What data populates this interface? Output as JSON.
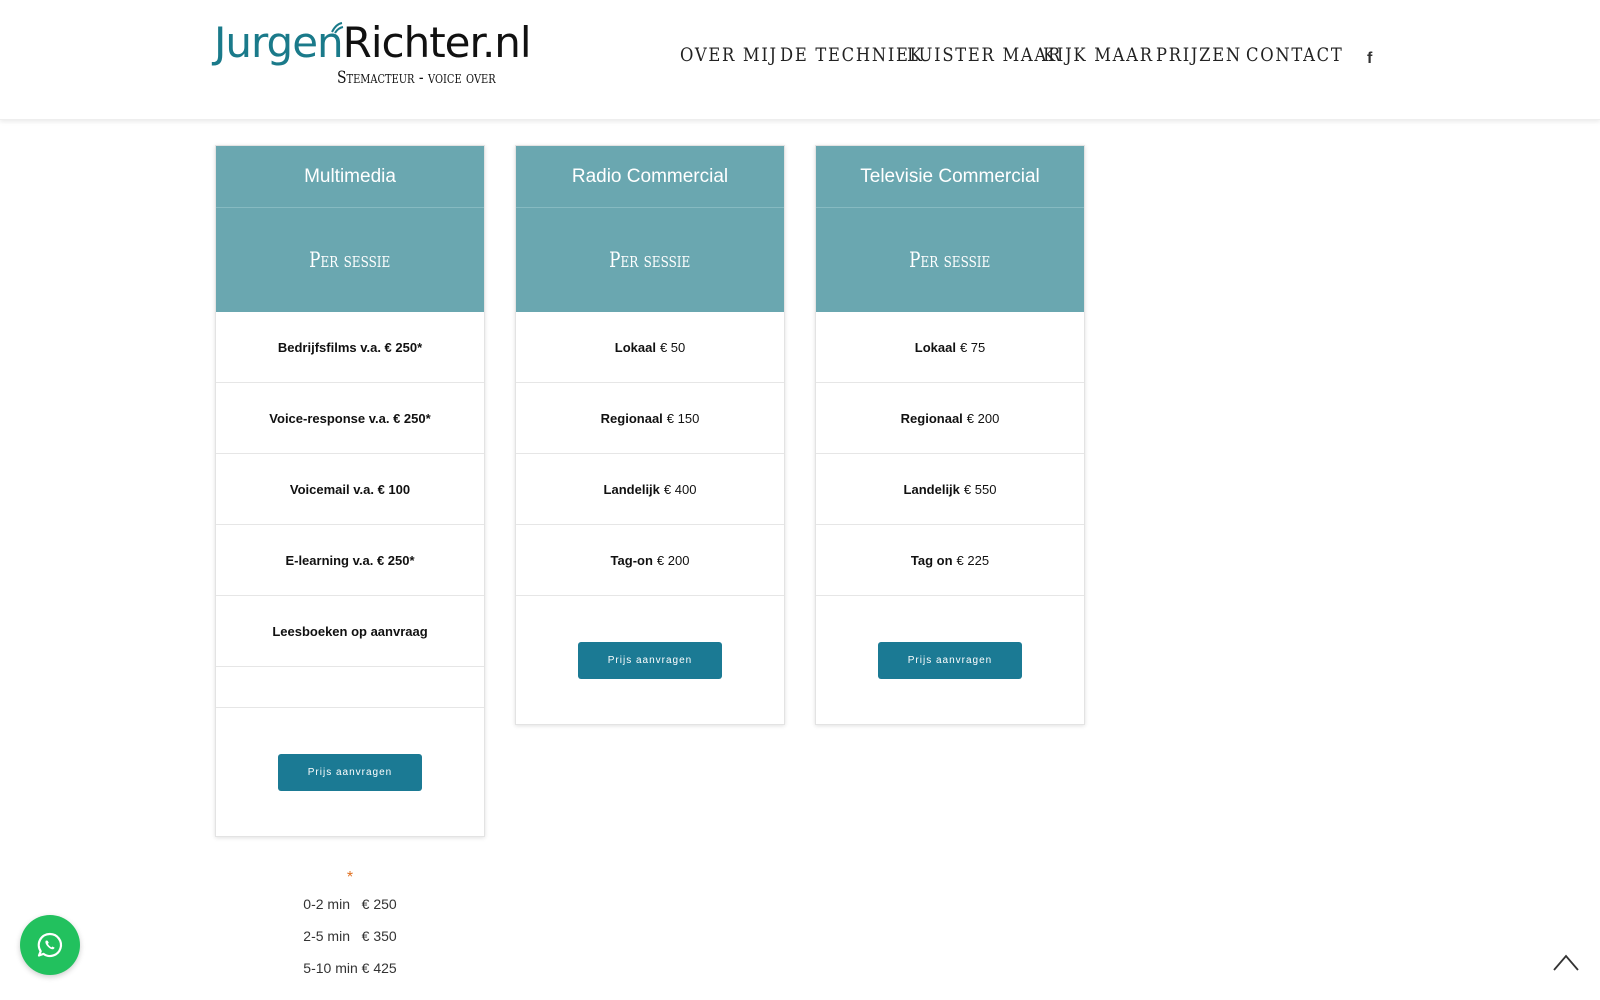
{
  "logo": {
    "first": "Jurgen",
    "last": "Richter.nl",
    "tagline": "Stemacteur - voice over"
  },
  "nav": {
    "items": [
      "OVER MIJ",
      "DE TECHNIEK",
      "LUISTER MAAR",
      "KIJK MAAR",
      "PRIJZEN",
      "CONTACT"
    ],
    "social_icon": "facebook-icon",
    "social_glyph": "f"
  },
  "cards": [
    {
      "title": "Multimedia",
      "subtitle": "Per sessie",
      "rows": [
        {
          "label": "Bedrijfsfilms v.a. € 250*",
          "price": ""
        },
        {
          "label": "Voice-response v.a. € 250*",
          "price": ""
        },
        {
          "label": "Voicemail v.a. € 100",
          "price": ""
        },
        {
          "label": "E-learning v.a. € 250*",
          "price": ""
        },
        {
          "label": "Leesboeken op aanvraag",
          "price": ""
        }
      ],
      "button": "Prijs aanvragen"
    },
    {
      "title": "Radio Commercial",
      "subtitle": "Per sessie",
      "rows": [
        {
          "label": "Lokaal",
          "price": "€ 50"
        },
        {
          "label": "Regionaal",
          "price": "€ 150"
        },
        {
          "label": "Landelijk",
          "price": "€ 400"
        },
        {
          "label": "Tag-on",
          "price": "€ 200"
        }
      ],
      "button": "Prijs aanvragen"
    },
    {
      "title": "Televisie Commercial",
      "subtitle": "Per sessie",
      "rows": [
        {
          "label": "Lokaal",
          "price": "€ 75"
        },
        {
          "label": "Regionaal",
          "price": "€ 200"
        },
        {
          "label": "Landelijk",
          "price": "€ 550"
        },
        {
          "label": "Tag on",
          "price": "€ 225"
        }
      ],
      "button": "Prijs aanvragen"
    }
  ],
  "footnote": {
    "marker": "*",
    "lines": [
      "0-2 min   € 250",
      "2-5 min   € 350",
      "5-10 min € 425"
    ]
  },
  "floating": {
    "whatsapp_icon": "whatsapp-icon",
    "back_to_top_icon": "chevron-up-icon"
  },
  "colors": {
    "card_header": "#6aa7b0",
    "button": "#1b7a94",
    "logo_accent": "#1a7a8a",
    "whatsapp": "#22c15e",
    "asterisk": "#e07020"
  }
}
